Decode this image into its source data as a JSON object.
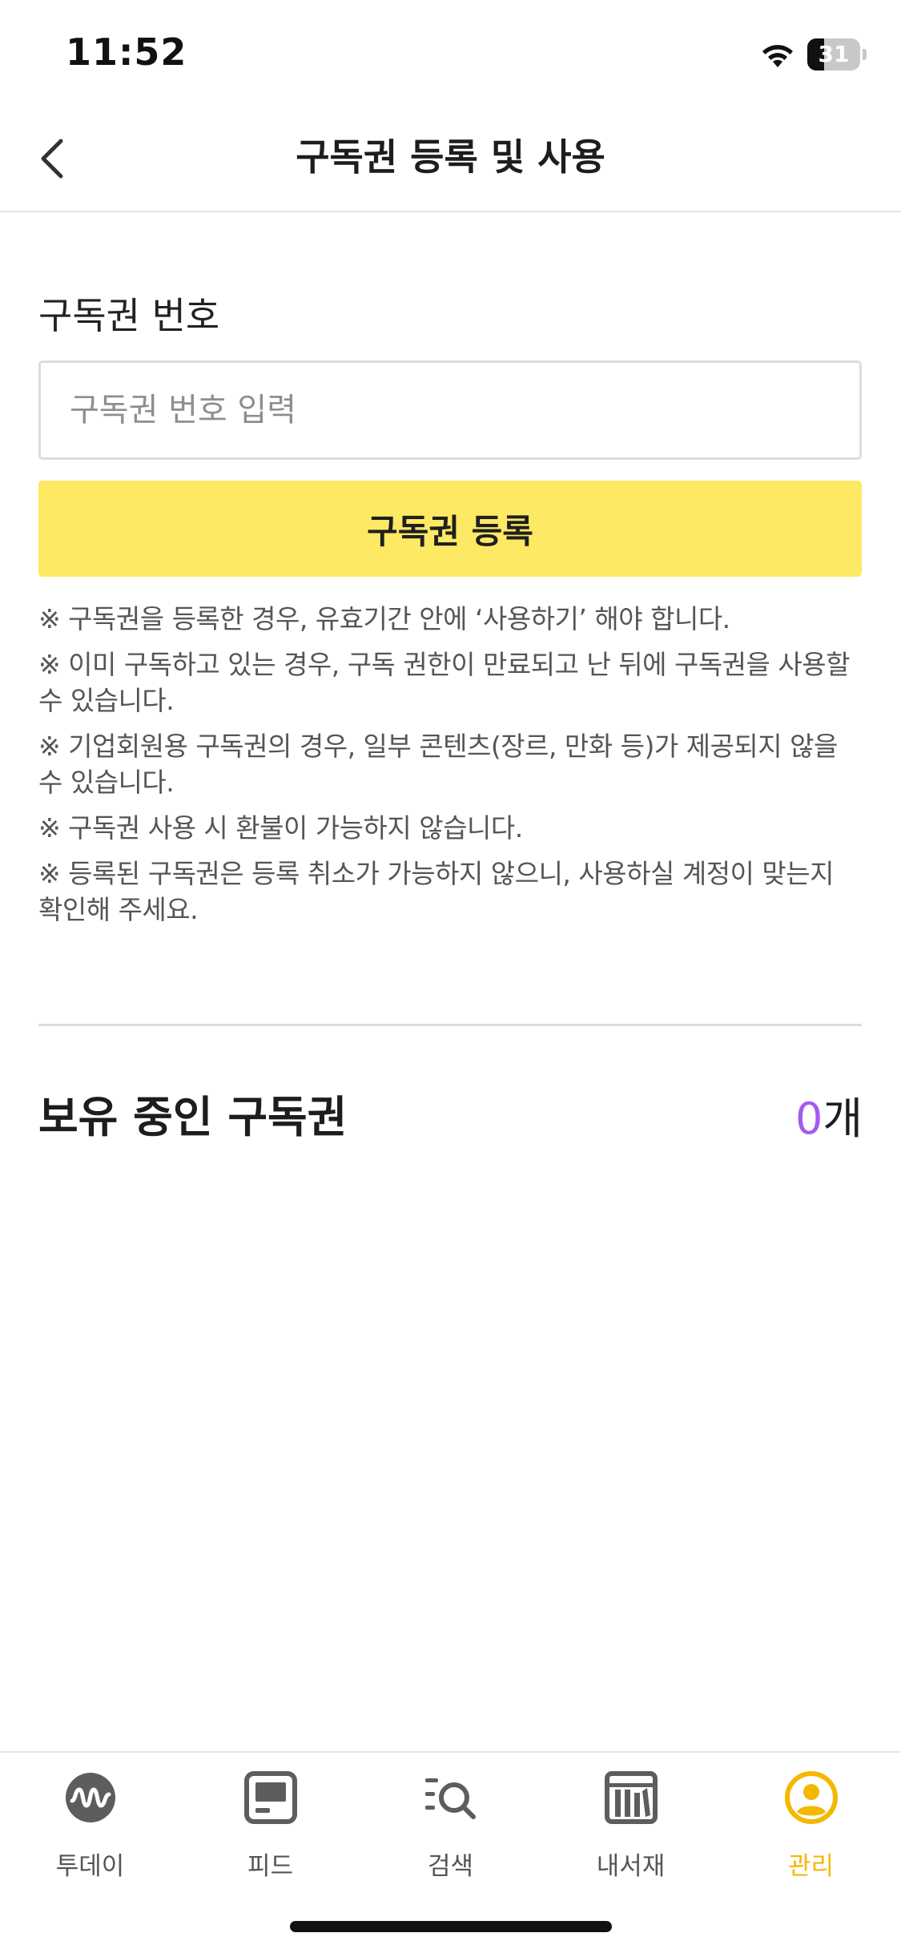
{
  "status_bar": {
    "time": "11:52",
    "battery": "31"
  },
  "header": {
    "title": "구독권 등록 및 사용",
    "back_icon": "chevron-left-icon"
  },
  "voucher": {
    "label": "구독권 번호",
    "input_value": "",
    "input_placeholder": "구독권 번호 입력",
    "register_button": "구독권 등록",
    "button_color": "#fde964",
    "notes": [
      "※ 구독권을 등록한 경우, 유효기간 안에 ‘사용하기’ 해야 합니다.",
      "※ 이미 구독하고 있는 경우, 구독 권한이 만료되고 난 뒤에 구독권을 사용할 수 있습니다.",
      "※ 기업회원용 구독권의 경우, 일부 콘텐츠(장르, 만화 등)가 제공되지 않을 수 있습니다.",
      "※ 구독권 사용 시 환불이 가능하지 않습니다.",
      "※ 등록된 구독권은 등록 취소가 가능하지 않으니, 사용하실 계정이 맞는지 확인해 주세요."
    ]
  },
  "owned": {
    "title": "보유 중인 구독권",
    "count": "0",
    "unit": "개",
    "count_color": "#a35af0"
  },
  "tabs": [
    {
      "label": "투데이",
      "icon": "today-wave-icon",
      "active": false
    },
    {
      "label": "피드",
      "icon": "feed-icon",
      "active": false
    },
    {
      "label": "검색",
      "icon": "search-list-icon",
      "active": false
    },
    {
      "label": "내서재",
      "icon": "bookshelf-icon",
      "active": false
    },
    {
      "label": "관리",
      "icon": "profile-icon",
      "active": true
    }
  ],
  "colors": {
    "active_tab": "#f5b800",
    "inactive_tab": "#555555"
  }
}
